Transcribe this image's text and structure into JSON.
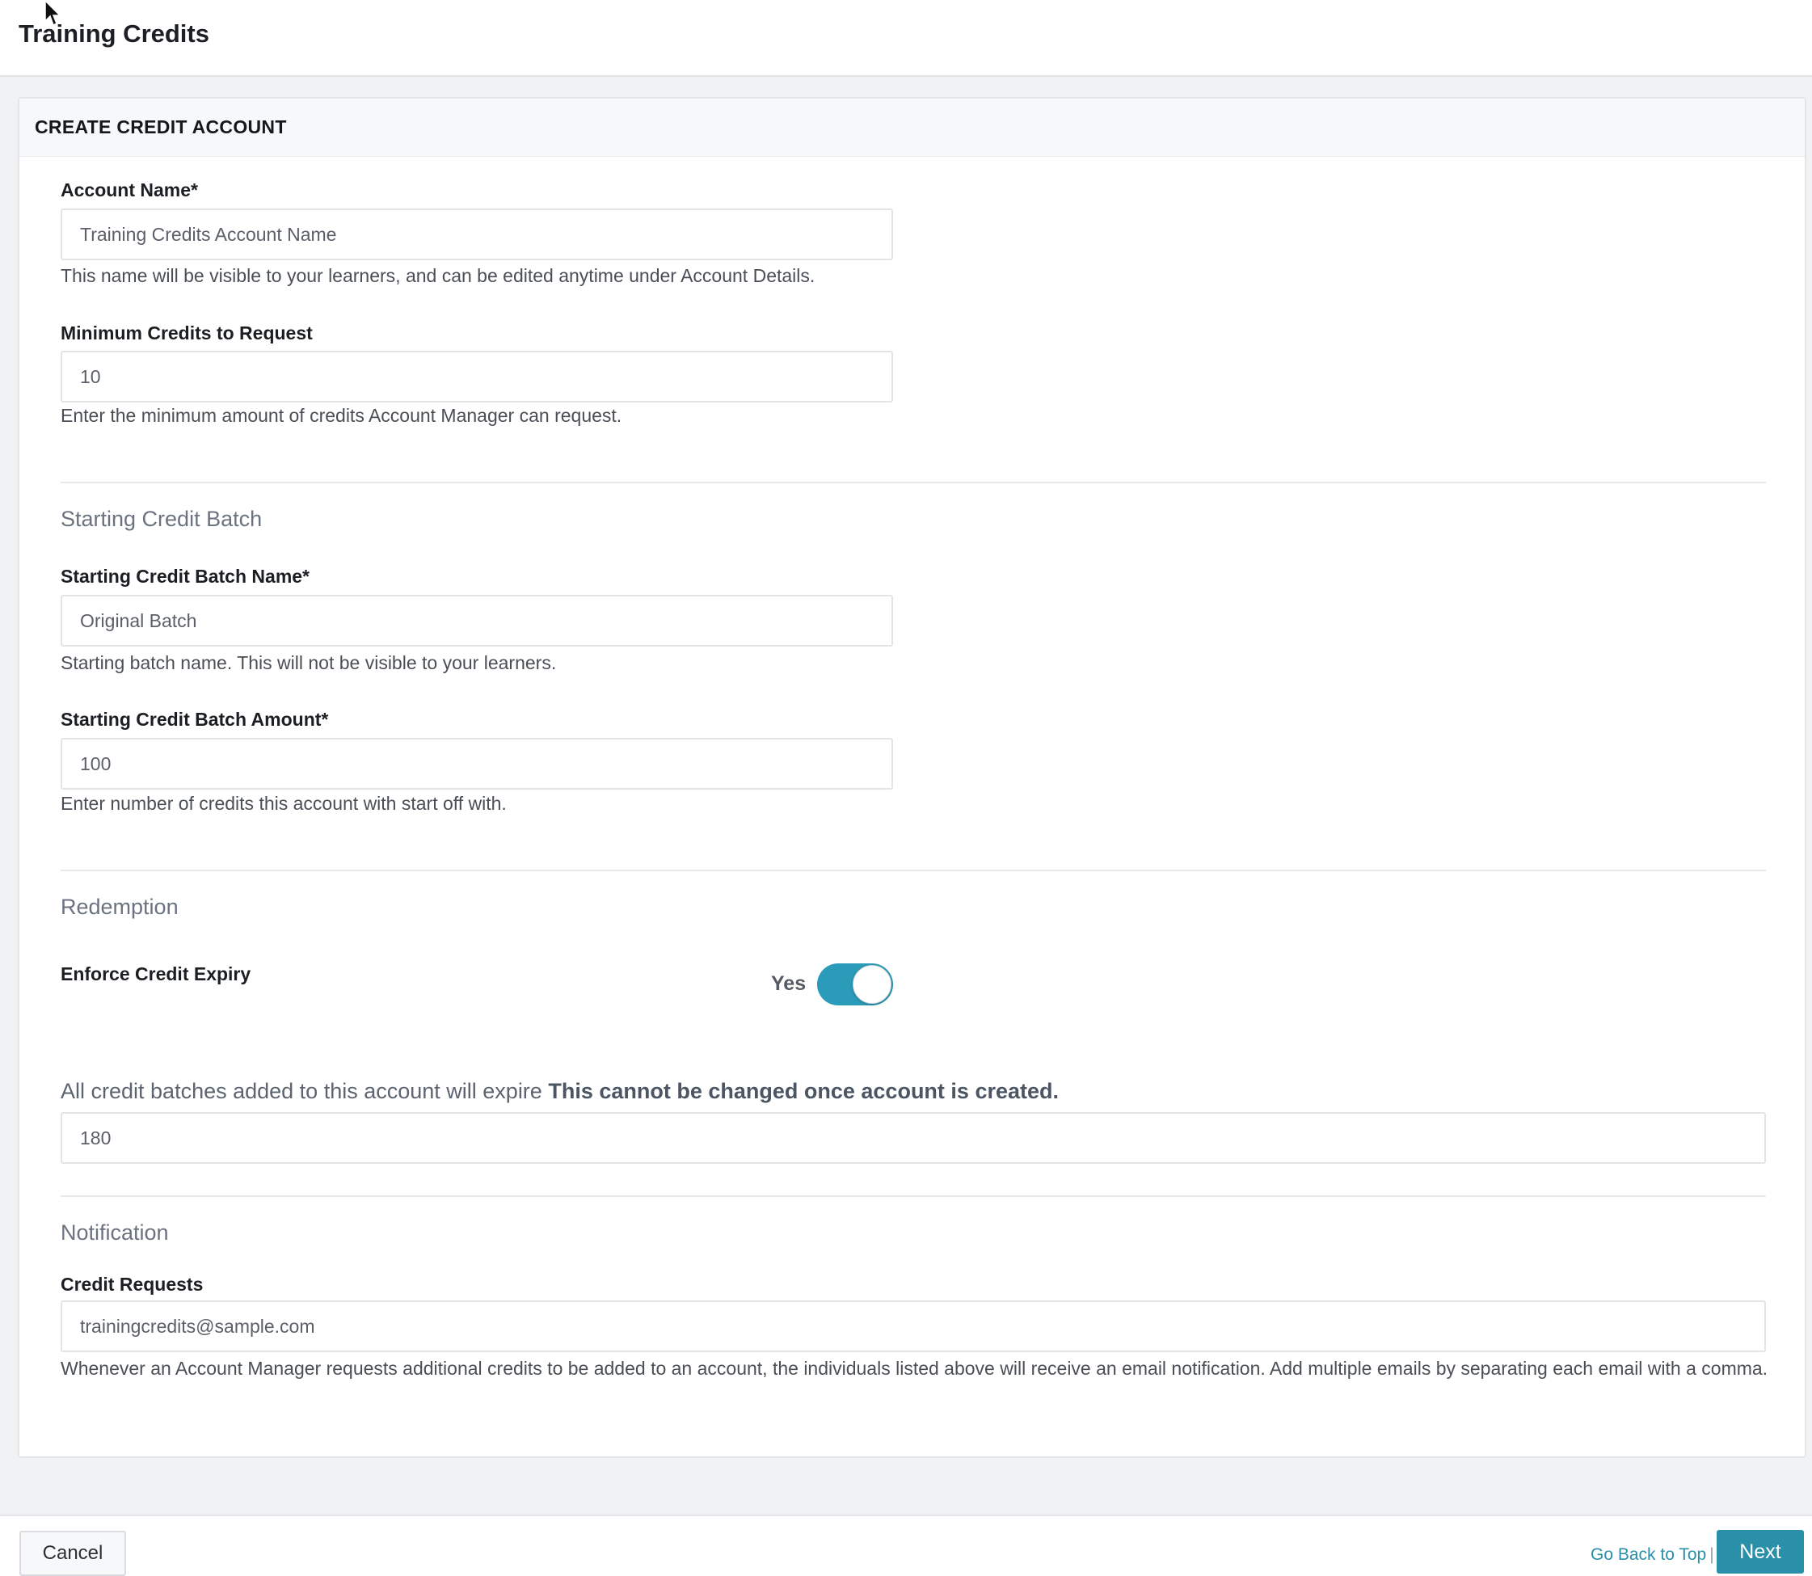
{
  "header": {
    "title": "Training Credits"
  },
  "card": {
    "title": "CREATE CREDIT ACCOUNT"
  },
  "account_name": {
    "label": "Account Name*",
    "placeholder": "Training Credits Account Name",
    "help": "This name will be visible to your learners, and can be edited anytime under Account Details."
  },
  "min_credits": {
    "label": "Minimum Credits to Request",
    "value": "10",
    "help": "Enter the minimum amount of credits Account Manager can request."
  },
  "starting_batch": {
    "section": "Starting Credit Batch",
    "name_label": "Starting Credit Batch Name*",
    "name_value": "Original Batch",
    "name_help": "Starting batch name. This will not be visible to your learners.",
    "amount_label": "Starting Credit Batch Amount*",
    "amount_value": "100",
    "amount_help": "Enter number of credits this account with start off with."
  },
  "redemption": {
    "section": "Redemption",
    "expiry_label": "Enforce Credit Expiry",
    "toggle_text": "Yes",
    "toggle_on": true,
    "expire_text": "All credit batches added to this account will expire",
    "expire_bold": "This cannot be changed once account is created.",
    "expire_value": "180"
  },
  "notification": {
    "section": "Notification",
    "requests_label": "Credit Requests",
    "requests_value": "trainingcredits@sample.com",
    "requests_help": "Whenever an Account Manager requests additional credits to be added to an account, the individuals listed above will receive an email notification. Add multiple emails by separating each email with a comma."
  },
  "footer": {
    "cancel_label": "Cancel",
    "back_top_label": "Go Back to Top",
    "separator": "|",
    "next_label": "Next"
  },
  "colors": {
    "accent": "#2a9bb8",
    "link": "#2a8fa8"
  }
}
